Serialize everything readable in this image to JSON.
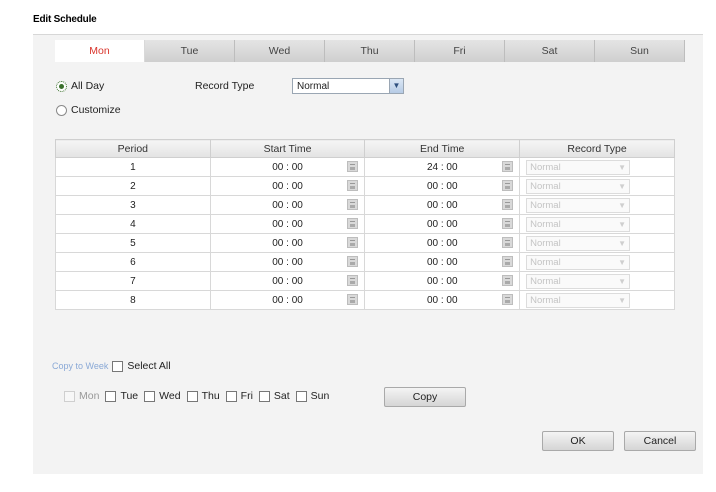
{
  "dialog": {
    "title": "Edit Schedule"
  },
  "tabs": [
    "Mon",
    "Tue",
    "Wed",
    "Thu",
    "Fri",
    "Sat",
    "Sun"
  ],
  "active_tab": "Mon",
  "mode": {
    "all_day_label": "All Day",
    "customize_label": "Customize",
    "selected": "All Day"
  },
  "record_type": {
    "label": "Record Type",
    "value": "Normal"
  },
  "table": {
    "headers": [
      "Period",
      "Start Time",
      "End Time",
      "Record Type"
    ],
    "rows": [
      {
        "period": "1",
        "start": "00 : 00",
        "end": "24 : 00",
        "type": "Normal"
      },
      {
        "period": "2",
        "start": "00 : 00",
        "end": "00 : 00",
        "type": "Normal"
      },
      {
        "period": "3",
        "start": "00 : 00",
        "end": "00 : 00",
        "type": "Normal"
      },
      {
        "period": "4",
        "start": "00 : 00",
        "end": "00 : 00",
        "type": "Normal"
      },
      {
        "period": "5",
        "start": "00 : 00",
        "end": "00 : 00",
        "type": "Normal"
      },
      {
        "period": "6",
        "start": "00 : 00",
        "end": "00 : 00",
        "type": "Normal"
      },
      {
        "period": "7",
        "start": "00 : 00",
        "end": "00 : 00",
        "type": "Normal"
      },
      {
        "period": "8",
        "start": "00 : 00",
        "end": "00 : 00",
        "type": "Normal"
      }
    ]
  },
  "copy": {
    "copy_to_week_label": "Copy to Week",
    "select_all_label": "Select All",
    "days": [
      "Mon",
      "Tue",
      "Wed",
      "Thu",
      "Fri",
      "Sat",
      "Sun"
    ],
    "copy_button": "Copy"
  },
  "footer": {
    "ok": "OK",
    "cancel": "Cancel"
  },
  "colors": {
    "active_tab": "#d9342b",
    "panel": "#f3f3f3",
    "link": "#8aa9d6"
  }
}
